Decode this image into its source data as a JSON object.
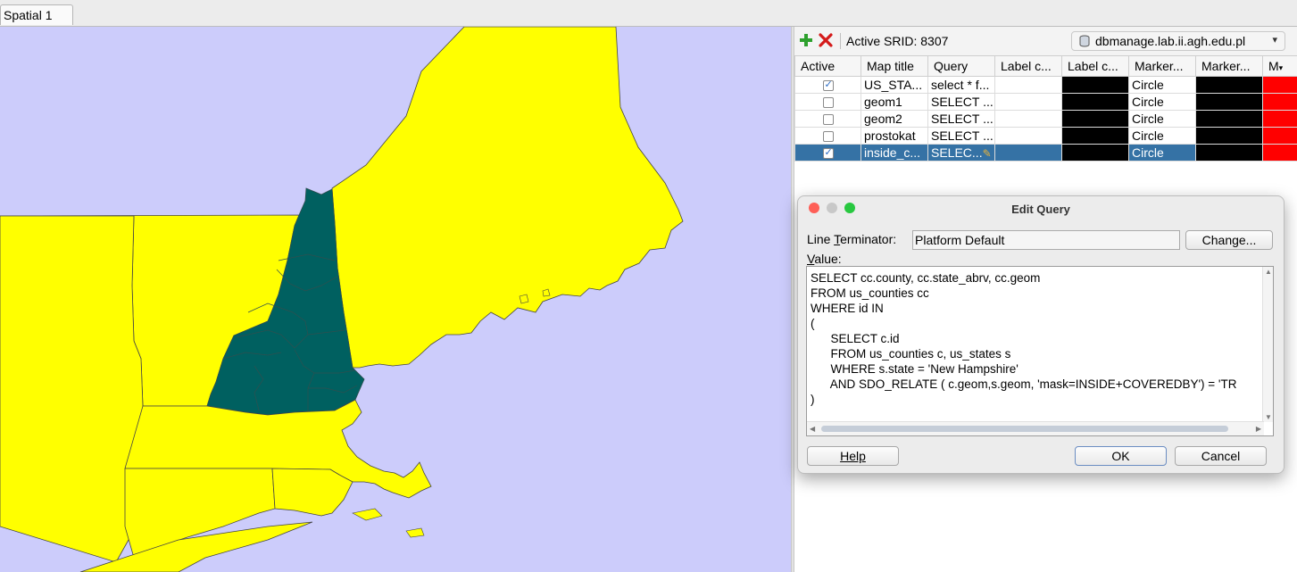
{
  "tab": {
    "label": "Spatial 1"
  },
  "map": {
    "background": "#ccccfb",
    "state_fill": "#ffff00",
    "highlight_fill": "#006060"
  },
  "toolbar": {
    "srid_label": "Active SRID: 8307",
    "connection": "dbmanage.lab.ii.agh.edu.pl"
  },
  "table": {
    "headers": [
      "Active",
      "Map title",
      "Query",
      "Label c...",
      "Label c...",
      "Marker...",
      "Marker...",
      "M"
    ],
    "rows": [
      {
        "active": true,
        "title": "US_STA...",
        "query": "select * f...",
        "marker": "Circle"
      },
      {
        "active": false,
        "title": "geom1",
        "query": "SELECT ...",
        "marker": "Circle"
      },
      {
        "active": false,
        "title": "geom2",
        "query": "SELECT ...",
        "marker": "Circle"
      },
      {
        "active": false,
        "title": "prostokat",
        "query": "SELECT  ...",
        "marker": "Circle"
      },
      {
        "active": true,
        "title": "inside_c...",
        "query": "SELEC...",
        "marker": "Circle"
      }
    ]
  },
  "dialog": {
    "title": "Edit Query",
    "line_terminator_label_pre": "Line ",
    "line_terminator_label_u": "T",
    "line_terminator_label_post": "erminator:",
    "line_terminator_value": "Platform Default",
    "change_button": "Change...",
    "value_label_pre": "",
    "value_label_u": "V",
    "value_label_post": "alue:",
    "query_text": "SELECT cc.county, cc.state_abrv, cc.geom\nFROM us_counties cc\nWHERE id IN\n(\n      SELECT c.id\n      FROM us_counties c, us_states s\n      WHERE s.state = 'New Hampshire'\n      AND SDO_RELATE ( c.geom,s.geom, 'mask=INSIDE+COVEREDBY') = 'TR\n)",
    "help_button": "Help",
    "ok_button": "OK",
    "cancel_button": "Cancel"
  }
}
